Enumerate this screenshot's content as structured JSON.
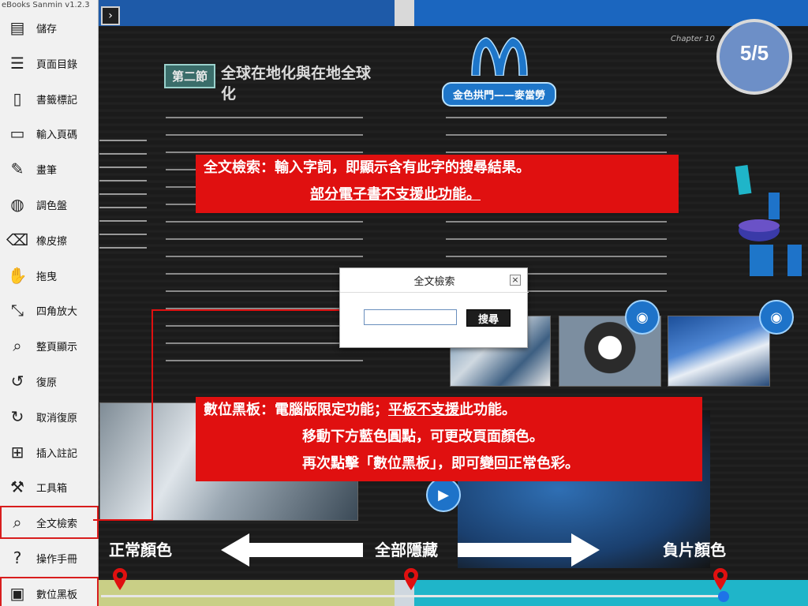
{
  "app": {
    "title": "eBooks Sanmin v1.2.3"
  },
  "collapse_button": {
    "glyph": "›"
  },
  "page_counter": {
    "current": "5/5"
  },
  "sidebar": {
    "items": [
      {
        "label": "儲存",
        "icon": "save-icon",
        "glyph": "▤"
      },
      {
        "label": "頁面目錄",
        "icon": "page-list-icon",
        "glyph": "☰"
      },
      {
        "label": "書籤標記",
        "icon": "bookmark-icon",
        "glyph": "▯"
      },
      {
        "label": "輸入頁碼",
        "icon": "book-page-icon",
        "glyph": "▭"
      },
      {
        "label": "畫筆",
        "icon": "pen-icon",
        "glyph": "✎"
      },
      {
        "label": "調色盤",
        "icon": "palette-icon",
        "glyph": "◍"
      },
      {
        "label": "橡皮擦",
        "icon": "eraser-icon",
        "glyph": "⌫"
      },
      {
        "label": "拖曳",
        "icon": "hand-icon",
        "glyph": "✋"
      },
      {
        "label": "四角放大",
        "icon": "zoom-corner-icon",
        "glyph": "⤡"
      },
      {
        "label": "整頁顯示",
        "icon": "fit-page-icon",
        "glyph": "⌕"
      },
      {
        "label": "復原",
        "icon": "undo-icon",
        "glyph": "↺"
      },
      {
        "label": "取消復原",
        "icon": "redo-icon",
        "glyph": "↻"
      },
      {
        "label": "插入註記",
        "icon": "annotation-icon",
        "glyph": "⊞"
      },
      {
        "label": "工具箱",
        "icon": "toolbox-icon",
        "glyph": "⚒"
      },
      {
        "label": "全文檢索",
        "icon": "fulltext-search-icon",
        "glyph": "⌕"
      },
      {
        "label": "操作手冊",
        "icon": "help-icon",
        "glyph": "?"
      },
      {
        "label": "數位黑板",
        "icon": "blackboard-icon",
        "glyph": "▣"
      }
    ]
  },
  "book": {
    "section_tag": "第二節",
    "section_title": "全球在地化與在地全球化",
    "chapter_label": "Chapter 10",
    "arch_banner": "金色拱門——麥當勞"
  },
  "callouts": {
    "search": {
      "line1": "全文檢索：輸入字詞，即顯示含有此字的搜尋結果。",
      "line2": "部分電子書不支援此功能。"
    },
    "blackboard": {
      "line1_a": "數位黑板：電腦版限定功能；",
      "line1_b": "平板不支援",
      "line1_c": "此功能。",
      "line2": "移動下方藍色圓點，可更改頁面顏色。",
      "line3": "再次點擊「數位黑板」，即可變回正常色彩。"
    }
  },
  "dialog": {
    "title": "全文檢索",
    "close_glyph": "×",
    "input_value": "",
    "search_button": "搜尋"
  },
  "color_modes": {
    "normal": "正常顏色",
    "hide_all": "全部隱藏",
    "negative": "負片顏色"
  },
  "colors": {
    "accent_red": "#e01010",
    "blue_dot": "#1e73e8"
  }
}
